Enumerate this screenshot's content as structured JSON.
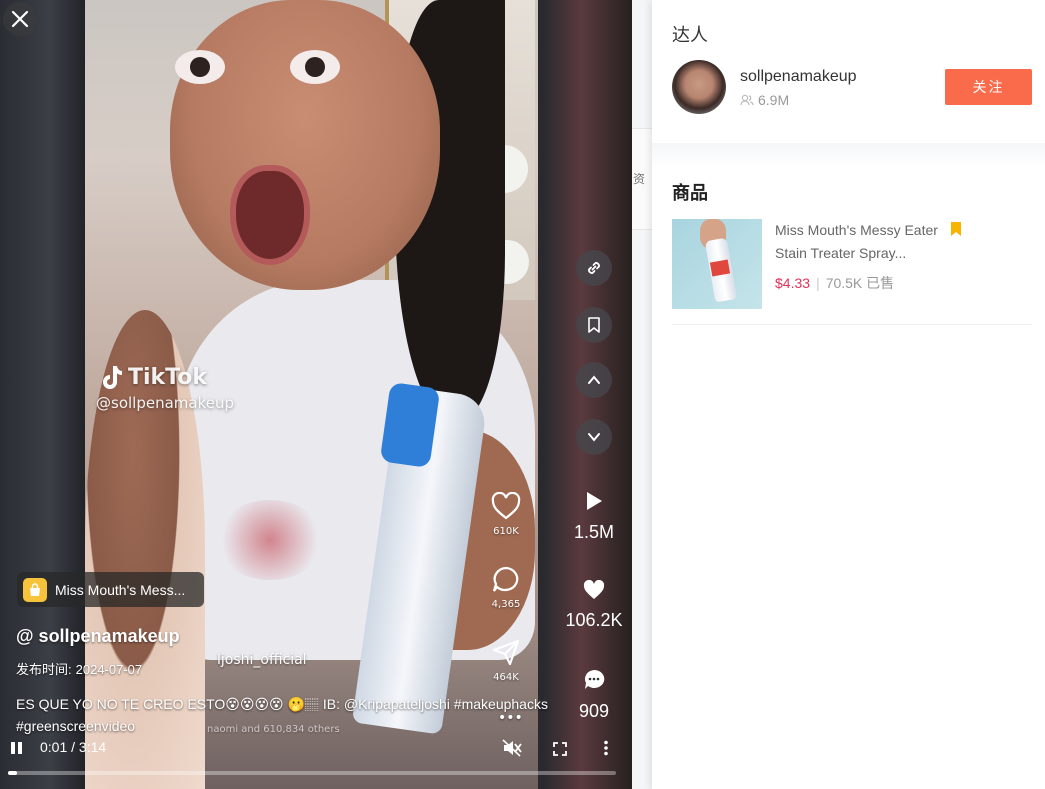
{
  "video": {
    "watermark_brand": "TikTok",
    "watermark_handle": "@sollpenamakeup",
    "inframe_like_count": "610K",
    "inframe_comment_count": "4,365",
    "inframe_share_count": "464K",
    "inframe_tag": "ljoshi_official",
    "inframe_liked_by": "naomi and 610,834 others",
    "product_chip_label": "Miss Mouth's Mess...",
    "author_handle": "@ sollpenamakeup",
    "publish_label": "发布时间:",
    "publish_date": "2024-07-07",
    "caption": "ES QUE YO NO TE CREO ESTO😵😵😵😵 🫢🏽 IB: @Kripapateljoshi #makeuphacks #greenscreenvideo",
    "current_time": "0:01",
    "duration": "3:14",
    "time_separator": " / ",
    "progress": 0.005
  },
  "stats": {
    "plays": "1.5M",
    "likes": "106.2K",
    "comments": "909"
  },
  "side_strip_text": "资",
  "panel": {
    "creator_section_title": "达人",
    "creator_name": "sollpenamakeup",
    "creator_followers": "6.9M",
    "follow_label": "关注",
    "products_section_title": "商品",
    "product": {
      "name": "Miss Mouth's Messy Eater Stain Treater Spray...",
      "price": "$4.33",
      "sold": "70.5K 已售"
    }
  },
  "colors": {
    "follow_button": "#fa6b4b",
    "price": "#e0305a",
    "bookmark": "#f7b500"
  }
}
